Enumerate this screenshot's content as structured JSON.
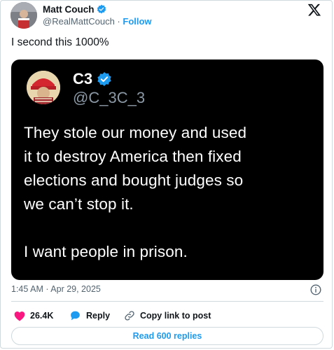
{
  "author": {
    "name": "Matt Couch",
    "handle": "@RealMattCouch",
    "separator": "·",
    "follow_label": "Follow"
  },
  "tweet": {
    "text": "I second this 1000%",
    "timestamp": "1:45 AM · Apr 29, 2025"
  },
  "quoted_screenshot": {
    "name": "C3",
    "handle": "@C_3C_3",
    "lines": [
      "They stole our money and used",
      "it to destroy America then fixed",
      "elections and bought judges so",
      "we can’t stop it.",
      "I want people in prison."
    ]
  },
  "actions": {
    "likes": "26.4K",
    "reply_label": "Reply",
    "copy_link_label": "Copy link to post"
  },
  "read_replies_label": "Read 600 replies",
  "colors": {
    "accent": "#1d9bf0",
    "like": "#f91880",
    "text": "#0f1419",
    "muted": "#536471",
    "border": "#cfd9de"
  },
  "icons": [
    "verified-badge-icon",
    "x-logo-icon",
    "info-icon",
    "heart-icon",
    "reply-bubble-icon",
    "link-icon"
  ]
}
